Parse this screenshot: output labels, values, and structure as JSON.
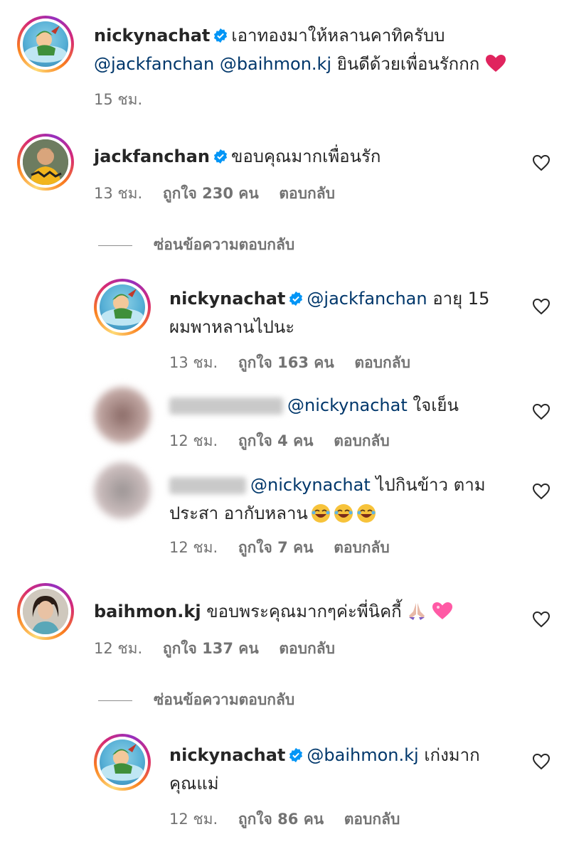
{
  "comments": [
    {
      "username": "nickynachat",
      "text_line1": "เอาทองมาให้หลานคาทิครับบ",
      "mention1": "@jackfanchan",
      "mention2": "@baihmon.kj",
      "text_line2": "ยินดีด้วยเพื่อนรักกก",
      "time": "15 ชม.",
      "emoji": "red-heart"
    },
    {
      "username": "jackfanchan",
      "text": "ขอบคุณมากเพื่อนรัก",
      "time": "13 ชม.",
      "likes": "ถูกใจ 230 คน",
      "reply_label": "ตอบกลับ",
      "hide_replies": "ซ่อนข้อความตอบกลับ",
      "replies": [
        {
          "username": "nickynachat",
          "mention": "@jackfanchan",
          "text_line1": "อายุ 15",
          "text_line2": "ผมพาหลานไปนะ",
          "time": "13 ชม.",
          "likes": "ถูกใจ 163 คน",
          "reply_label": "ตอบกลับ"
        },
        {
          "username_blurred": true,
          "mention": "@nickynachat",
          "text": "ใจเย็น",
          "time": "12 ชม.",
          "likes": "ถูกใจ 4 คน",
          "reply_label": "ตอบกลับ"
        },
        {
          "username_blurred": true,
          "mention": "@nickynachat",
          "text_line1": "ไปกินข้าว ตาม",
          "text_line2": "ประสา อากับหลาน",
          "time": "12 ชม.",
          "likes": "ถูกใจ 7 คน",
          "reply_label": "ตอบกลับ",
          "emoji": "laughing-face x3"
        }
      ]
    },
    {
      "username": "baihmon.kj",
      "text": "ขอบพระคุณมากๆค่ะพี่นิคกี้",
      "time": "12 ชม.",
      "likes": "ถูกใจ 137 คน",
      "reply_label": "ตอบกลับ",
      "hide_replies": "ซ่อนข้อความตอบกลับ",
      "emoji": "praying-hands, pink-heart",
      "replies": [
        {
          "username": "nickynachat",
          "mention": "@baihmon.kj",
          "text_line1": "เก่งมาก",
          "text_line2": "คุณแม่",
          "time": "12 ชม.",
          "likes": "ถูกใจ 86 คน",
          "reply_label": "ตอบกลับ"
        }
      ]
    }
  ],
  "colors": {
    "mention": "#00376b",
    "meta": "#737373",
    "verified": "#0095f6",
    "heart": "#e0245e"
  }
}
